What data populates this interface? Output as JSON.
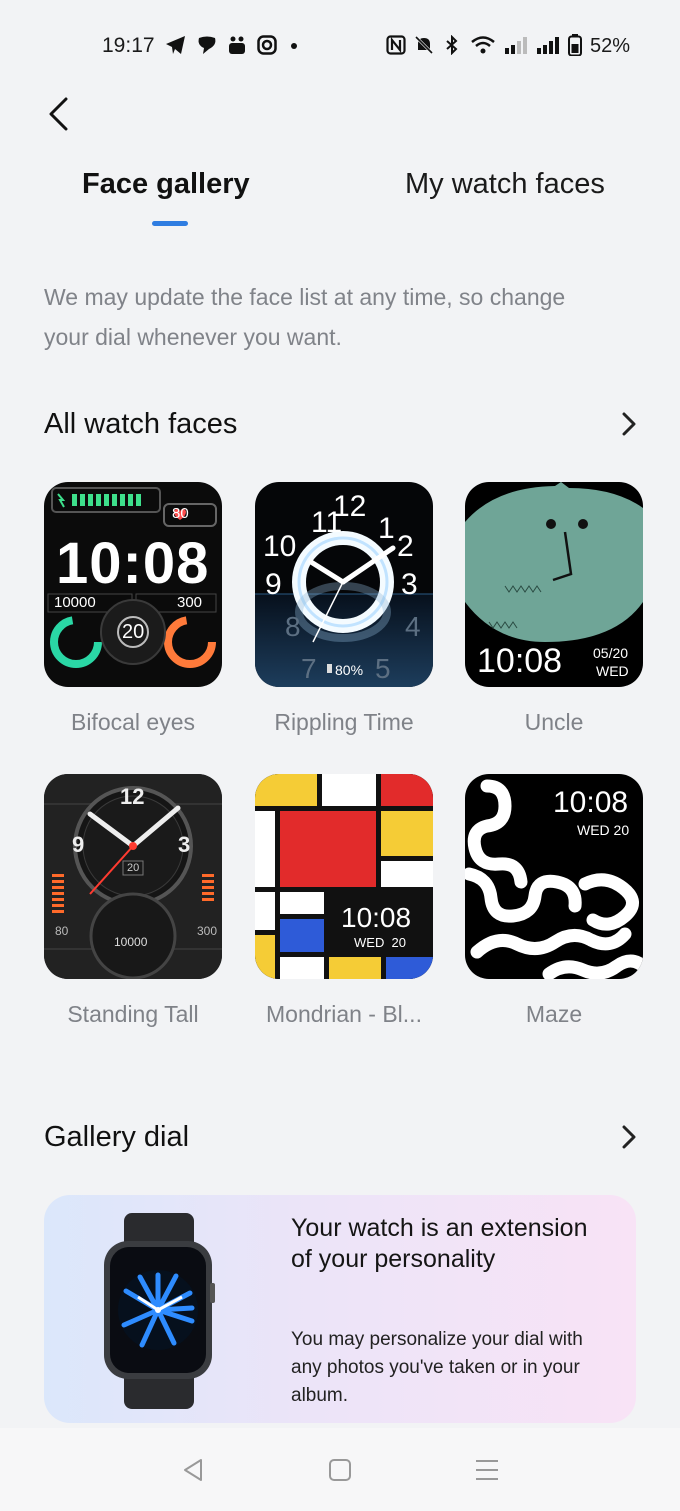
{
  "status_bar": {
    "time": "19:17",
    "battery": "52%",
    "icons_left": [
      "telegram-icon",
      "chat-icon",
      "app-icon",
      "instagram-icon",
      "dot-icon"
    ],
    "icons_right": [
      "nfc-icon",
      "mute-icon",
      "bluetooth-icon",
      "wifi-icon",
      "signal-icon",
      "signal-icon",
      "battery-icon"
    ]
  },
  "tabs": [
    {
      "label": "Face gallery",
      "active": true
    },
    {
      "label": "My watch faces",
      "active": false
    }
  ],
  "intro_text": "We may update the face list at any time, so change your dial whenever you want.",
  "all_faces": {
    "title": "All watch faces",
    "items": [
      {
        "name": "Bifocal eyes",
        "time": "10:08",
        "heart": "80",
        "steps": "10000",
        "cal": "300",
        "day": "20"
      },
      {
        "name": "Rippling Time",
        "battery": "80%"
      },
      {
        "name": "Uncle",
        "time": "10:08",
        "date": "05/20",
        "weekday": "WED"
      },
      {
        "name": "Standing Tall",
        "date": "20",
        "steps": "10000",
        "left": "80",
        "right": "300"
      },
      {
        "name": "Mondrian - Bl...",
        "time": "10:08",
        "date": "WED  20"
      },
      {
        "name": "Maze",
        "time": "10:08",
        "date": "WED 20"
      }
    ]
  },
  "gallery_dial": {
    "title": "Gallery dial",
    "card_title": "Your watch is an extension of your personality",
    "card_body": "You may personalize your dial with any photos you've taken or in your album."
  },
  "colors": {
    "accent": "#2f7de1",
    "background": "#f2f3f5",
    "muted_text": "#808389"
  }
}
